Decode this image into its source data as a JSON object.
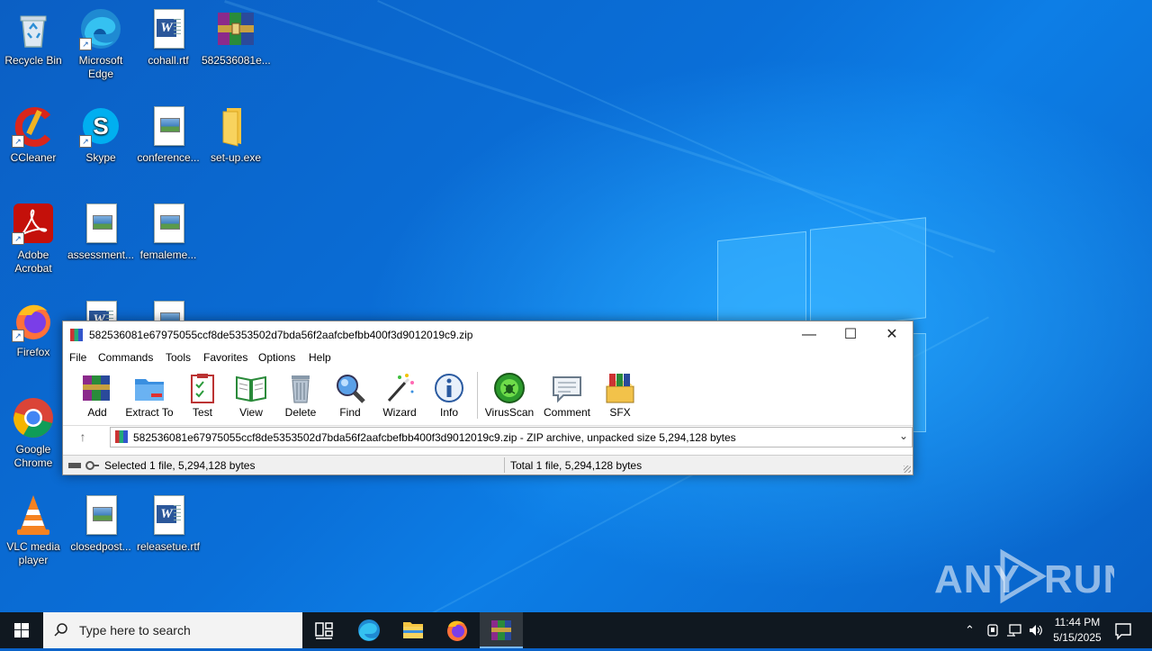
{
  "desktop": {
    "icons": [
      {
        "label": "Recycle Bin"
      },
      {
        "label": "Microsoft Edge"
      },
      {
        "label": "cohall.rtf"
      },
      {
        "label": "582536081e..."
      },
      {
        "label": "CCleaner"
      },
      {
        "label": "Skype"
      },
      {
        "label": "conference..."
      },
      {
        "label": "set-up.exe"
      },
      {
        "label": "Adobe Acrobat"
      },
      {
        "label": "assessment..."
      },
      {
        "label": "femaleme..."
      },
      {
        "label": "Firefox"
      },
      {
        "label": "Google Chrome"
      },
      {
        "label": "VLC media player"
      },
      {
        "label": "closedpost..."
      },
      {
        "label": "releasetue.rtf"
      }
    ],
    "watermark": "ANY RUN"
  },
  "winrar": {
    "title": "582536081e67975055ccf8de5353502d7bda56f2aafcbefbb400f3d9012019c9.zip",
    "menu": [
      "File",
      "Commands",
      "Tools",
      "Favorites",
      "Options",
      "Help"
    ],
    "toolbar": [
      "Add",
      "Extract To",
      "Test",
      "View",
      "Delete",
      "Find",
      "Wizard",
      "Info",
      "VirusScan",
      "Comment",
      "SFX"
    ],
    "address": "582536081e67975055ccf8de5353502d7bda56f2aafcbefbb400f3d9012019c9.zip - ZIP archive, unpacked size 5,294,128 bytes",
    "status_left": "Selected 1 file, 5,294,128 bytes",
    "status_right": "Total 1 file, 5,294,128 bytes"
  },
  "taskbar": {
    "search_placeholder": "Type here to search",
    "time": "11:44 PM",
    "date": "5/15/2025"
  }
}
